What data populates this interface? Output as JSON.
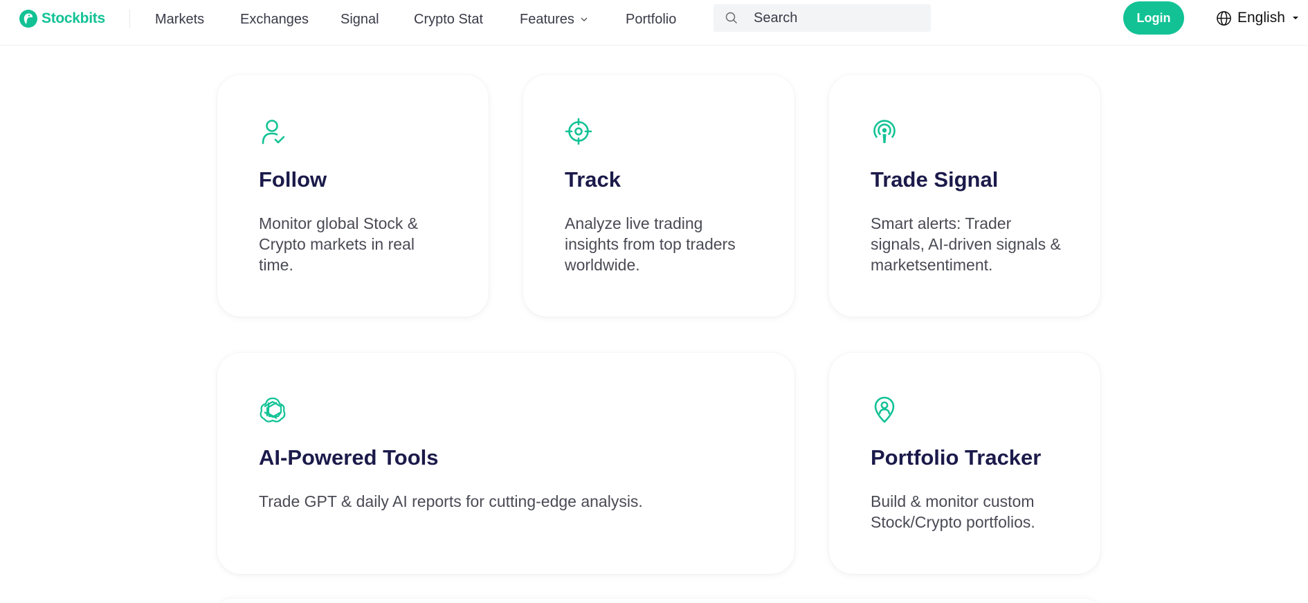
{
  "header": {
    "logo_text": "Stockbits",
    "nav": [
      {
        "label": "Markets"
      },
      {
        "label": "Exchanges"
      },
      {
        "label": "Signal"
      },
      {
        "label": "Crypto Stat"
      },
      {
        "label": "Features",
        "has_dropdown": true
      },
      {
        "label": "Portfolio"
      }
    ],
    "search_placeholder": "Search",
    "login_label": "Login",
    "language": "English"
  },
  "colors": {
    "accent": "#12c295",
    "heading": "#1b1a4a",
    "body_text": "#4a4a55"
  },
  "cards": [
    {
      "icon": "user-check-icon",
      "title": "Follow",
      "description": "Monitor global Stock & Crypto markets in real time."
    },
    {
      "icon": "crosshair-icon",
      "title": "Track",
      "description": "Analyze live trading insights from top traders worldwide."
    },
    {
      "icon": "broadcast-signal-icon",
      "title": "Trade Signal",
      "description": "Smart alerts: Trader signals, AI-driven signals & marketsentiment."
    },
    {
      "icon": "ai-knot-icon",
      "title": "AI-Powered Tools",
      "description": "Trade GPT & daily AI reports for cutting-edge analysis."
    },
    {
      "icon": "location-user-icon",
      "title": "Portfolio Tracker",
      "description": "Build & monitor custom Stock/Crypto portfolios."
    }
  ]
}
